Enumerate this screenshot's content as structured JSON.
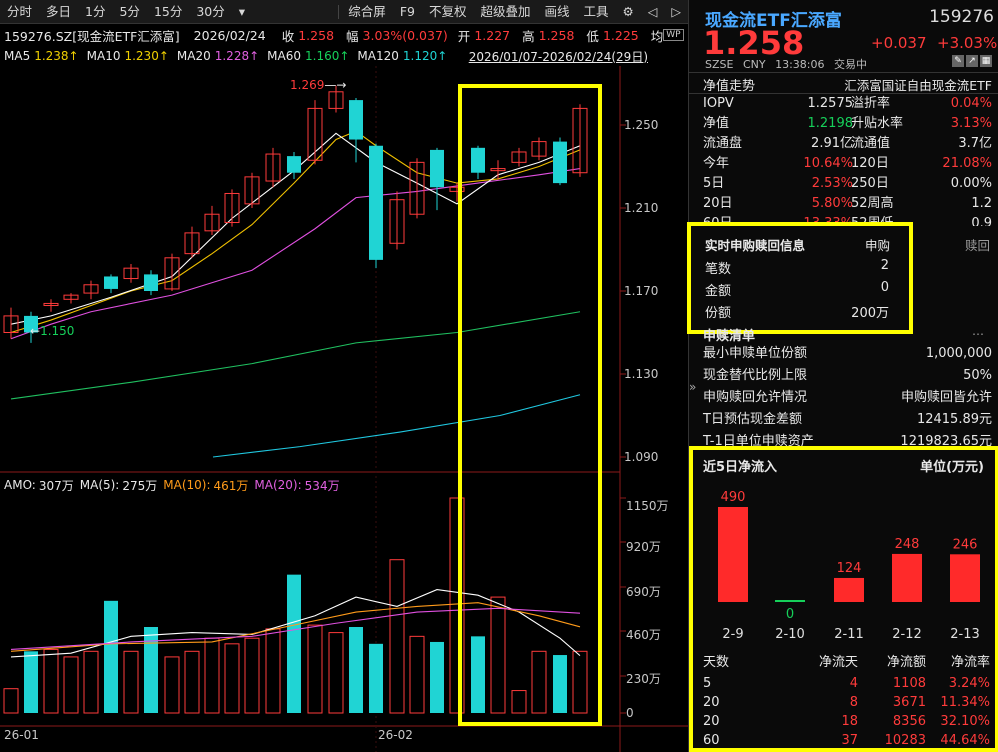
{
  "toolbar": {
    "left": [
      "分时",
      "多日",
      "1分",
      "5分",
      "15分",
      "30分"
    ],
    "dropdown": "▾",
    "right": [
      "综合屏",
      "F9",
      "不复权",
      "超级叠加",
      "画线",
      "工具"
    ]
  },
  "info": {
    "code": "159276.SZ[现金流ETF汇添富]",
    "date": "2026/02/24",
    "close_label": "收",
    "close": "1.258",
    "change_label": "幅",
    "change": "3.03%(0.037)",
    "open_label": "开",
    "open": "1.227",
    "high_label": "高",
    "high": "1.258",
    "low_label": "低",
    "low": "1.225",
    "avg_label": "均"
  },
  "ma": {
    "ma5_label": "MA5",
    "ma5": "1.238↑",
    "ma10_label": "MA10",
    "ma10": "1.230↑",
    "ma20_label": "MA20",
    "ma20": "1.228↑",
    "ma60_label": "MA60",
    "ma60": "1.160↑",
    "ma120_label": "MA120",
    "ma120": "1.120↑",
    "range": "2026/01/07-2026/02/24(29日)"
  },
  "price_axis": [
    "1.250",
    "1.210",
    "1.170",
    "1.130",
    "1.090"
  ],
  "annotations": {
    "high": "1.269",
    "low": "1.150"
  },
  "volume_header": {
    "amo_label": "AMO:",
    "amo": "307万",
    "ma5_label": "MA(5):",
    "ma5": "275万",
    "ma10_label": "MA(10):",
    "ma10": "461万",
    "ma20_label": "MA(20):",
    "ma20": "534万"
  },
  "volume_axis": [
    "1150万",
    "920万",
    "690万",
    "460万",
    "230万",
    "0"
  ],
  "date_axis": [
    "26-01",
    "26-02"
  ],
  "colors": {
    "up": "#ff3b3b",
    "down": "#20d4d4",
    "ma5": "#ffffff",
    "ma10": "#f0c000",
    "ma20": "#e050e0",
    "ma60": "#20c060",
    "ma120": "#20c8e0",
    "highlight": "#ffff00"
  },
  "panel": {
    "name": "现金流ETF汇添富",
    "code": "159276",
    "price": "1.258",
    "change": "+0.037",
    "change_pct": "+3.03%",
    "exchange": "SZSE",
    "currency": "CNY",
    "time": "13:38:06",
    "status": "交易中",
    "trend_label": "净值走势",
    "index_name": "汇添富国证自由现金流ETF",
    "stats": [
      {
        "l1": "IOPV",
        "v1": "1.2575",
        "l2": "溢折率",
        "v2": "0.04%"
      },
      {
        "l1": "净值",
        "v1": "1.2198",
        "l2": "升贴水率",
        "v2": "3.13%"
      },
      {
        "l1": "流通盘",
        "v1": "2.91亿",
        "l2": "流通值",
        "v2": "3.7亿"
      },
      {
        "l1": "今年",
        "v1": "10.64%",
        "l2": "120日",
        "v2": "21.08%"
      },
      {
        "l1": "5日",
        "v1": "2.53%",
        "l2": "250日",
        "v2": "0.00%"
      },
      {
        "l1": "20日",
        "v1": "5.80%",
        "l2": "52周高",
        "v2": "1.2"
      },
      {
        "l1": "60日",
        "v1": "13.33%",
        "l2": "52周低",
        "v2": "0.9"
      }
    ],
    "subs": {
      "title": "实时申购赎回信息",
      "col1": "申购",
      "col2": "赎回",
      "rows": [
        {
          "label": "笔数",
          "v": "2"
        },
        {
          "label": "金额",
          "v": "0"
        },
        {
          "label": "份额",
          "v": "200万"
        }
      ]
    },
    "list_title": "申赎清单",
    "list": [
      {
        "label": "最小申赎单位份额",
        "value": "1,000,000"
      },
      {
        "label": "现金替代比例上限",
        "value": "50%"
      },
      {
        "label": "申购赎回允许情况",
        "value": "申购赎回皆允许"
      },
      {
        "label": "T日预估现金差额",
        "value": "12415.89元"
      },
      {
        "label": "T-1日单位申赎资产",
        "value": "1219823.65元"
      }
    ],
    "flow": {
      "title": "近5日净流入",
      "unit": "单位(万元)",
      "bars": [
        {
          "date": "2-9",
          "value": 490
        },
        {
          "date": "2-10",
          "value": 0
        },
        {
          "date": "2-11",
          "value": 124
        },
        {
          "date": "2-12",
          "value": 248
        },
        {
          "date": "2-13",
          "value": 246
        }
      ],
      "table_headers": [
        "天数",
        "净流天",
        "净流额",
        "净流率"
      ],
      "table": [
        [
          "5",
          "4",
          "1108",
          "3.24%"
        ],
        [
          "20",
          "8",
          "3671",
          "11.34%"
        ],
        [
          "20",
          "18",
          "8356",
          "32.10%"
        ],
        [
          "60",
          "37",
          "10283",
          "44.64%"
        ]
      ]
    }
  }
}
